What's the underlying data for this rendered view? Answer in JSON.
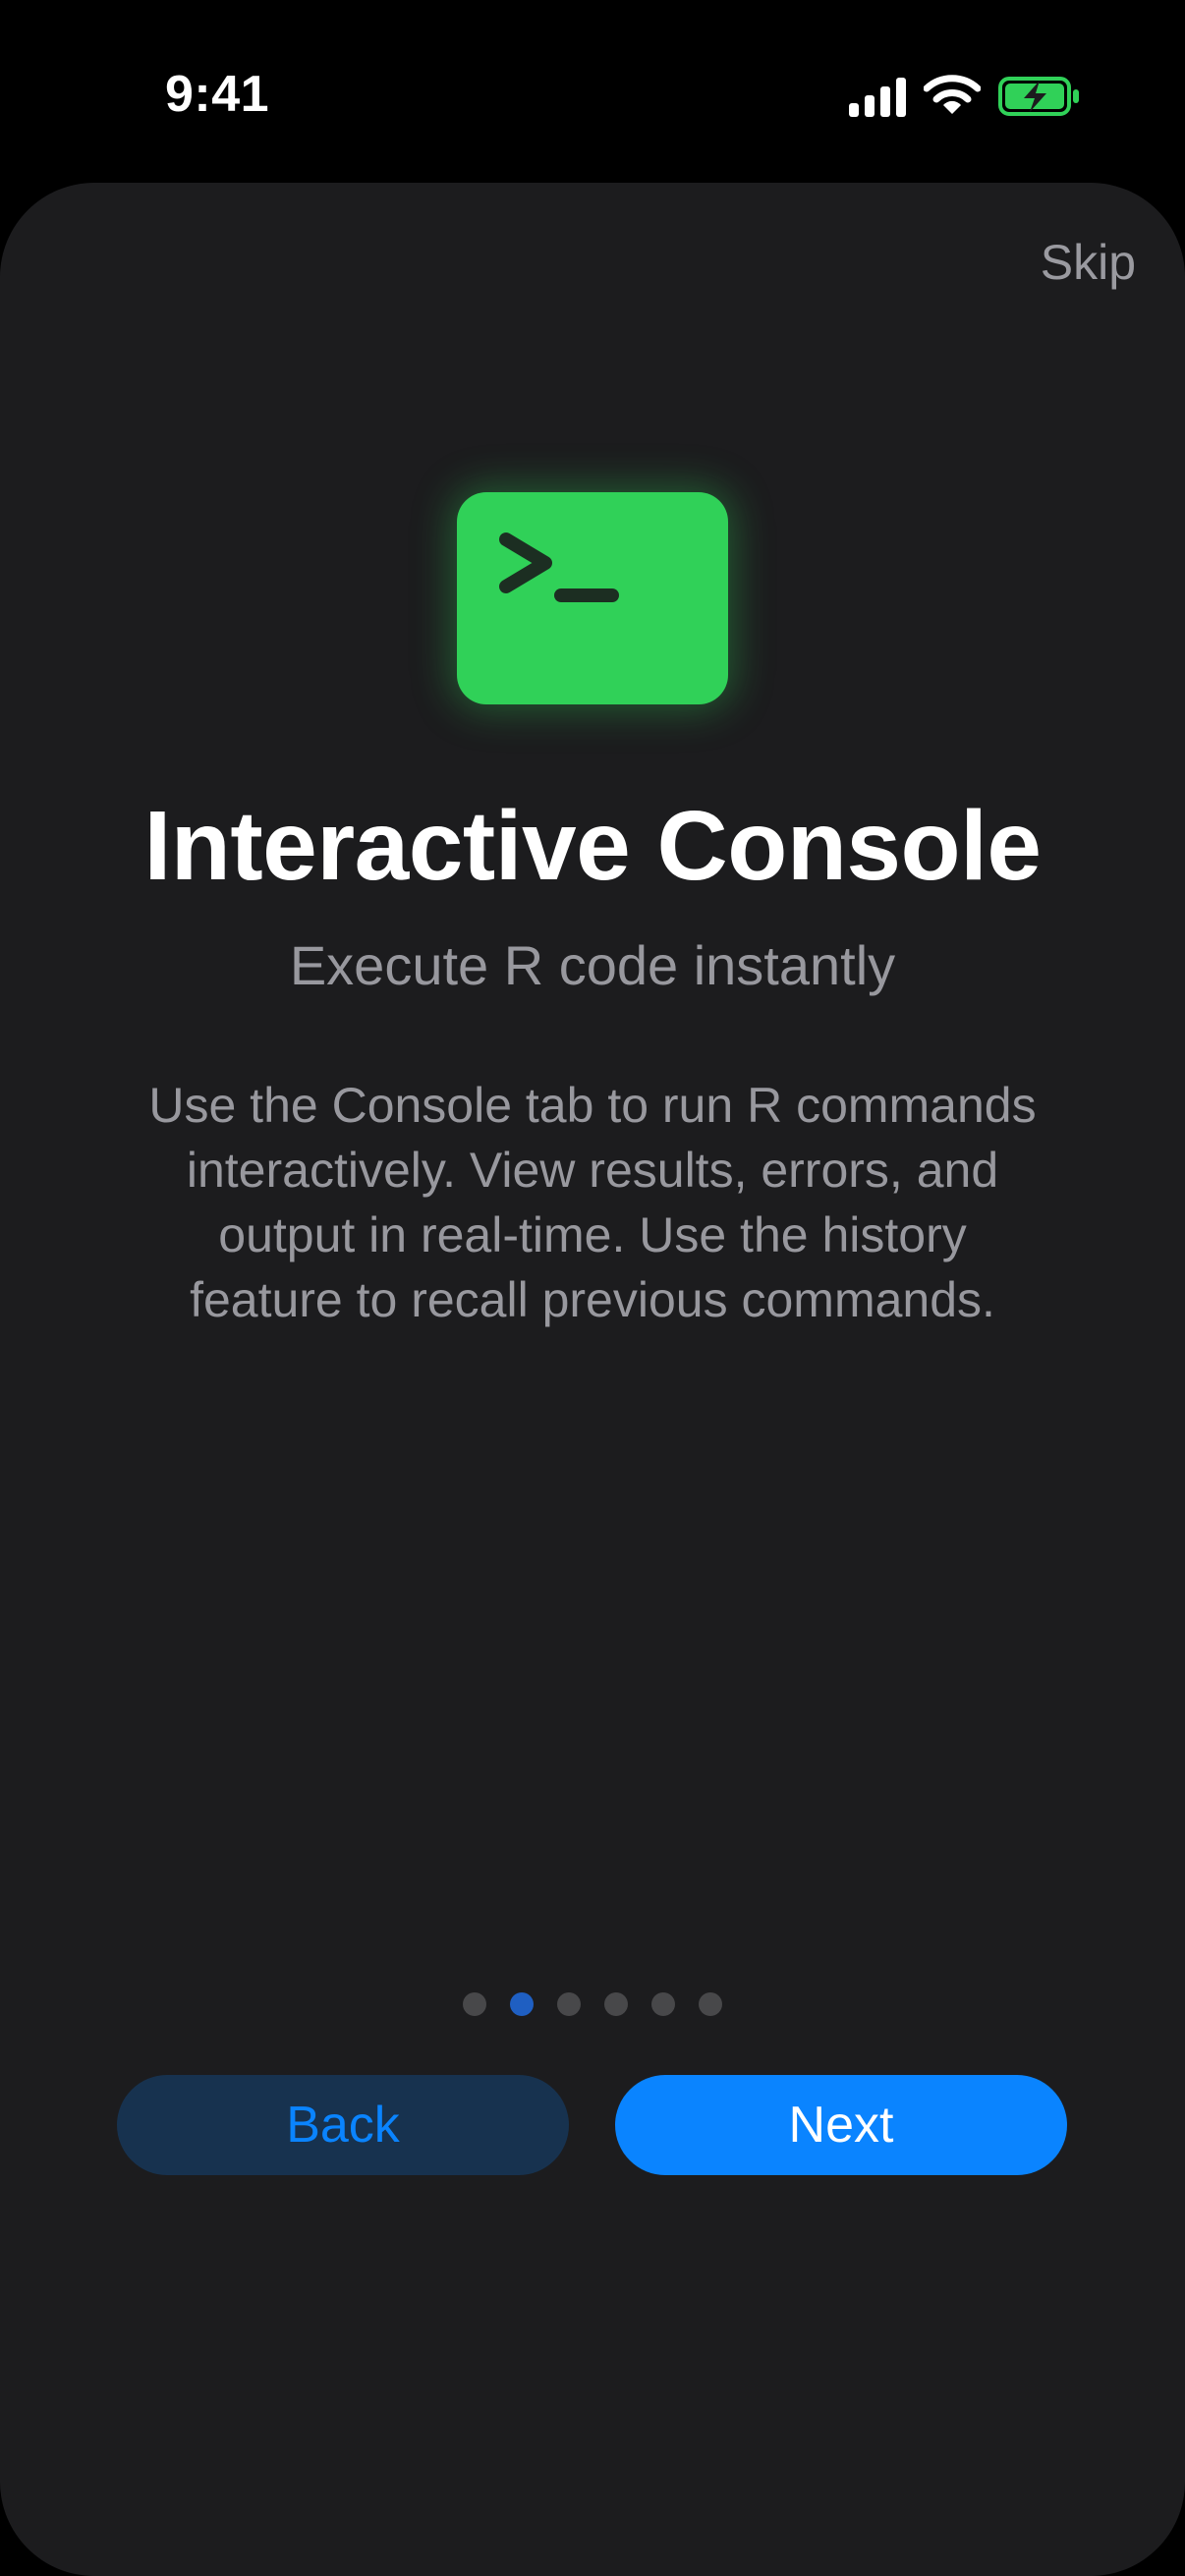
{
  "status_bar": {
    "time": "9:41",
    "icons": [
      "signal-icon",
      "wifi-icon",
      "battery-charging-icon"
    ],
    "battery_color": "#30d158"
  },
  "onboarding": {
    "skip_label": "Skip",
    "icon": "terminal-icon",
    "icon_color": "#30d158",
    "title": "Interactive Console",
    "subtitle": "Execute R code instantly",
    "description": "Use the Console tab to run R commands interactively. View results, errors, and output in real-time. Use the history feature to recall previous commands.",
    "page_indicator": {
      "total": 6,
      "current": 2
    }
  },
  "actions": {
    "back_label": "Back",
    "next_label": "Next"
  },
  "colors": {
    "background": "#1c1c1e",
    "accent": "#0a84ff"
  }
}
